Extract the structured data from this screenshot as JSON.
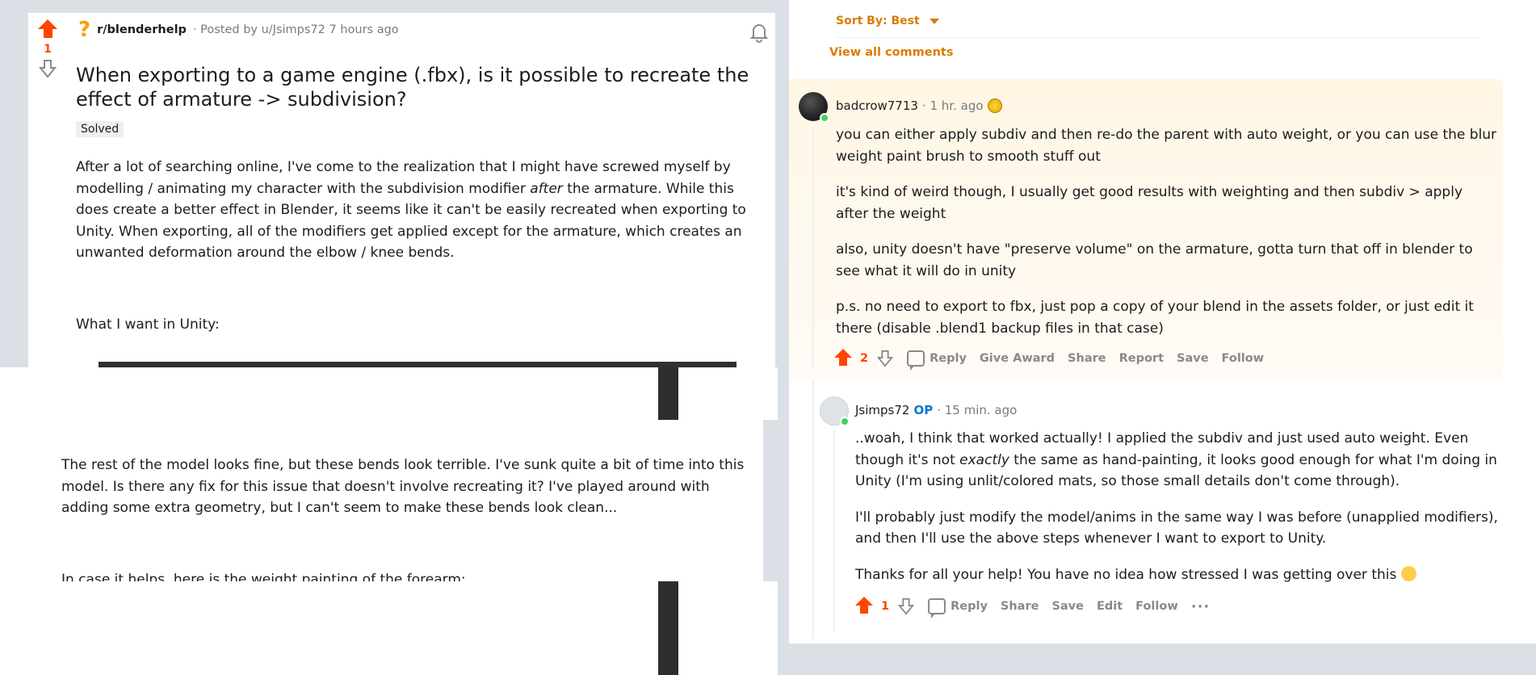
{
  "post": {
    "vote_count": "1",
    "subreddit": "r/blenderhelp",
    "meta": "· Posted by u/Jsimps72 7 hours ago",
    "title": "When exporting to a game engine (.fbx), is it possible to recreate the effect of armature -> subdivision?",
    "flair": "Solved",
    "body_p1_a": "After a lot of searching online, I've come to the realization that I might have screwed myself by modelling / animating my character with the subdivision modifier ",
    "body_p1_em": "after",
    "body_p1_b": " the armature. While this does create a better effect in Blender, it seems like it can't be easily recreated when exporting to Unity. When exporting, all of the modifiers get applied except for the armature, which creates an unwanted deformation around the elbow / knee bends.",
    "body_p2": "What I want in Unity:",
    "body_p3": "The rest of the model looks fine, but these bends look terrible. I've sunk quite a bit of time into this model. Is there any fix for this issue that doesn't involve recreating it? I've played around with adding some extra geometry, but I can't seem to make these bends look clean...",
    "body_p4": "In case it helps, here is the weight painting of the forearm:"
  },
  "comments": {
    "sort_label": "Sort By: Best",
    "view_all": "View all comments",
    "c1": {
      "user": "badcrow7713",
      "time": "· 1 hr. ago",
      "p1": "you can either apply subdiv and then re-do the parent with auto weight, or you can use the blur weight paint brush to smooth stuff out",
      "p2": "it's kind of weird though, I usually get good results with weighting and then subdiv > apply after the weight",
      "p3": "also, unity doesn't have \"preserve volume\" on the armature, gotta turn that off in blender to see what it will do in unity",
      "p4": "p.s. no need to export to fbx, just pop a copy of your blend in the assets folder, or just edit it there (disable .blend1 backup files in that case)",
      "votes": "2",
      "actions": [
        "Reply",
        "Give Award",
        "Share",
        "Report",
        "Save",
        "Follow"
      ]
    },
    "c2": {
      "user": "Jsimps72",
      "op": "OP",
      "time": "· 15 min. ago",
      "p1_a": "..woah, I think that worked actually! I applied the subdiv and just used auto weight. Even though it's not ",
      "p1_em": "exactly",
      "p1_b": " the same as hand-painting, it looks good enough for what I'm doing in Unity (I'm using unlit/colored mats, so those small details don't come through).",
      "p2": "I'll probably just modify the model/anims in the same way I was before (unapplied modifiers), and then I'll use the above steps whenever I want to export to Unity.",
      "p3": "Thanks for all your help! You have no idea how stressed I was getting over this",
      "votes": "1",
      "actions": [
        "Reply",
        "Share",
        "Save",
        "Edit",
        "Follow"
      ],
      "more": "···"
    }
  }
}
